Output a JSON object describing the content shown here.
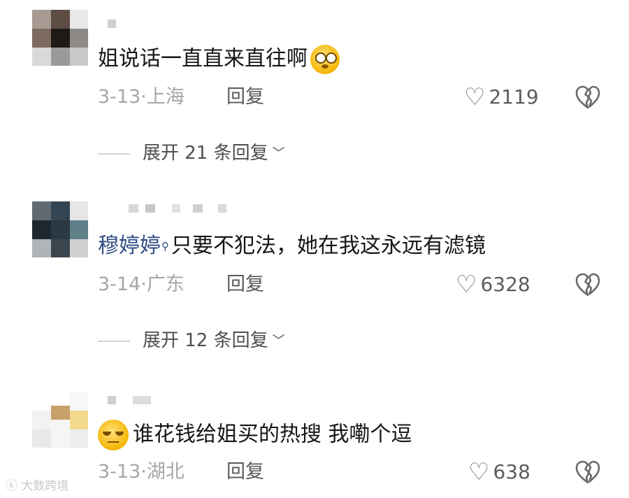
{
  "comments": [
    {
      "text": "姐说话一直直来直往啊",
      "date": "3-13",
      "location": "上海",
      "reply_label": "回复",
      "likes": "2119",
      "expand_label": "展开 21 条回复"
    },
    {
      "mention": "穆婷婷",
      "text": "只要不犯法，她在我这永远有滤镜",
      "date": "3-14",
      "location": "广东",
      "reply_label": "回复",
      "likes": "6328",
      "expand_label": "展开 12 条回复"
    },
    {
      "text": "谁花钱给姐买的热搜 我嘞个逗",
      "date": "3-13",
      "location": "湖北",
      "reply_label": "回复",
      "likes": "638"
    }
  ],
  "separator": "·",
  "watermark": "大数跨境",
  "icons": {
    "like": "heart-outline-icon",
    "dislike": "broken-heart-icon",
    "expand": "chevron-down-icon",
    "mention": "search-icon"
  },
  "colors": {
    "text": "#161616",
    "meta": "#a6a6a6",
    "mention": "#2f4d83"
  }
}
